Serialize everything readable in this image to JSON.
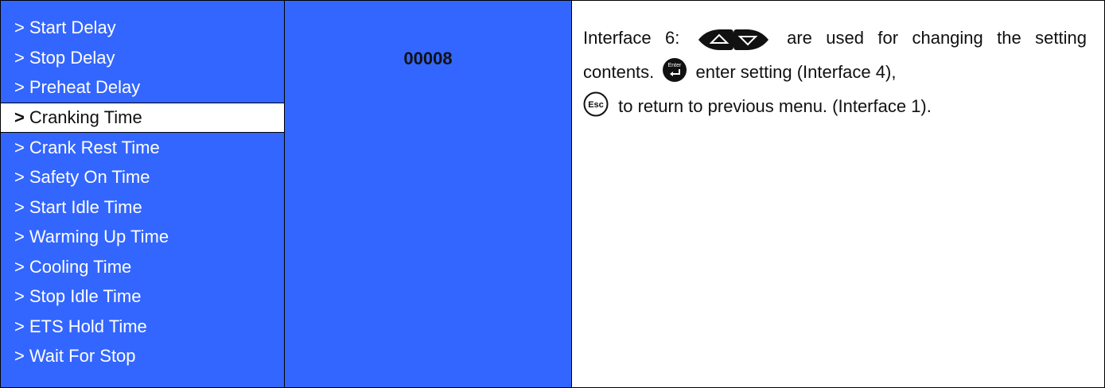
{
  "menu": {
    "items": [
      {
        "label": "Start Delay"
      },
      {
        "label": "Stop Delay"
      },
      {
        "label": "Preheat Delay"
      },
      {
        "label": "Cranking Time",
        "selected": true
      },
      {
        "label": "Crank Rest Time"
      },
      {
        "label": "Safety On Time"
      },
      {
        "label": "Start Idle Time"
      },
      {
        "label": "Warming Up Time"
      },
      {
        "label": "Cooling Time"
      },
      {
        "label": "Stop Idle Time"
      },
      {
        "label": "ETS Hold Time"
      },
      {
        "label": "Wait For Stop"
      }
    ],
    "marker": ">"
  },
  "value": {
    "text": "00008"
  },
  "description": {
    "prefix": "Interface 6:",
    "text1": "are used for changing the setting contents.",
    "text2": "enter setting (Interface 4),",
    "text3": "to return to previous menu. (Interface 1).",
    "icons": [
      "up-down-arrow-keys-icon",
      "enter-key-icon",
      "esc-key-icon"
    ],
    "enter_key_label": "Enter",
    "esc_key_label": "Esc"
  },
  "colors": {
    "panel_blue": "#3366ff",
    "brand_red": "#e02020"
  }
}
